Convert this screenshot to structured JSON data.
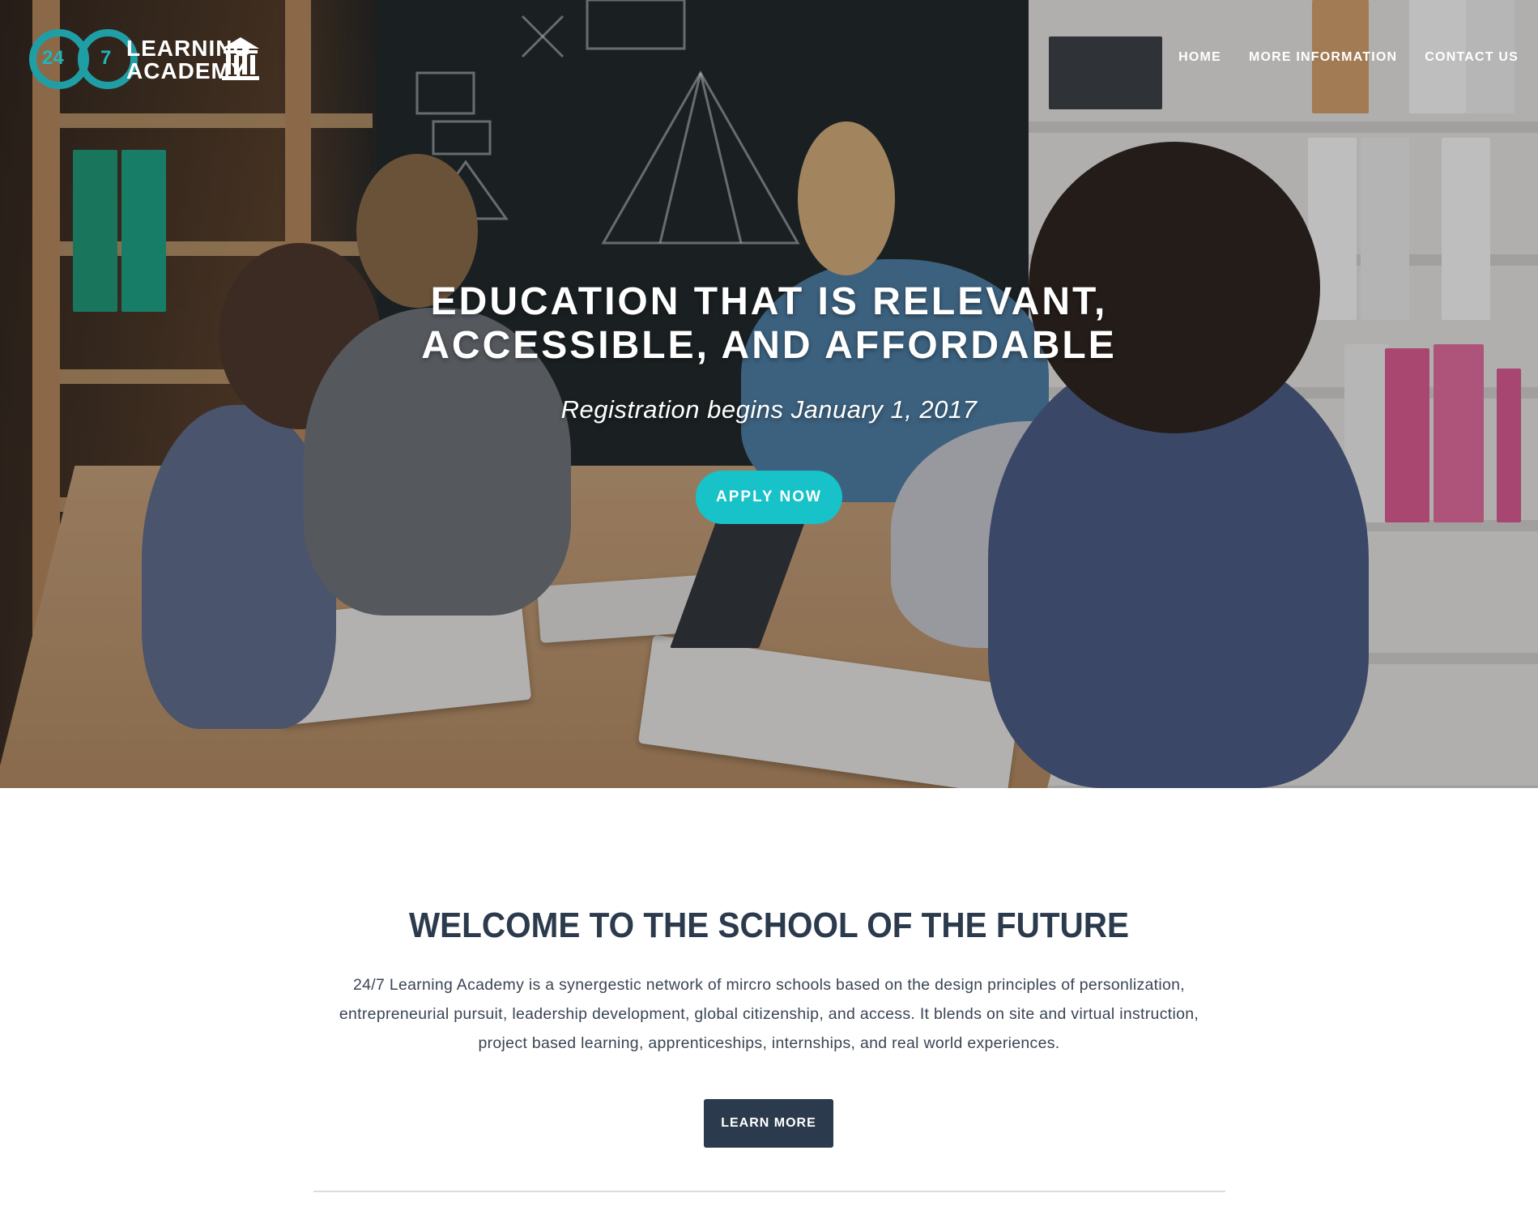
{
  "logo": {
    "num1": "24",
    "num2": "7",
    "word1": "LEARNING",
    "word2": "ACADEMY",
    "icon": "building-columns-icon"
  },
  "nav": {
    "items": [
      {
        "label": "HOME"
      },
      {
        "label": "MORE INFORMATION"
      },
      {
        "label": "CONTACT US"
      }
    ]
  },
  "hero": {
    "title_line1": "EDUCATION THAT IS RELEVANT,",
    "title_line2": "ACCESSIBLE, AND AFFORDABLE",
    "subtitle": "Registration begins January 1, 2017",
    "cta_label": "APPLY NOW"
  },
  "welcome": {
    "title": "WELCOME TO THE SCHOOL OF THE FUTURE",
    "body_line1": "24/7 Learning Academy is a synergestic network of mircro schools based on the design principles of personlization,",
    "body_line2": "entrepreneurial pursuit, leadership development, global citizenship, and access. It blends on site and virtual instruction,",
    "body_line3": "project based learning, apprenticeships, internships, and real world experiences.",
    "button_label": "LEARN MORE"
  },
  "colors": {
    "accent": "#17c2c9",
    "dark_navy": "#2b3a4c",
    "logo_teal": "#1f9fa5"
  }
}
